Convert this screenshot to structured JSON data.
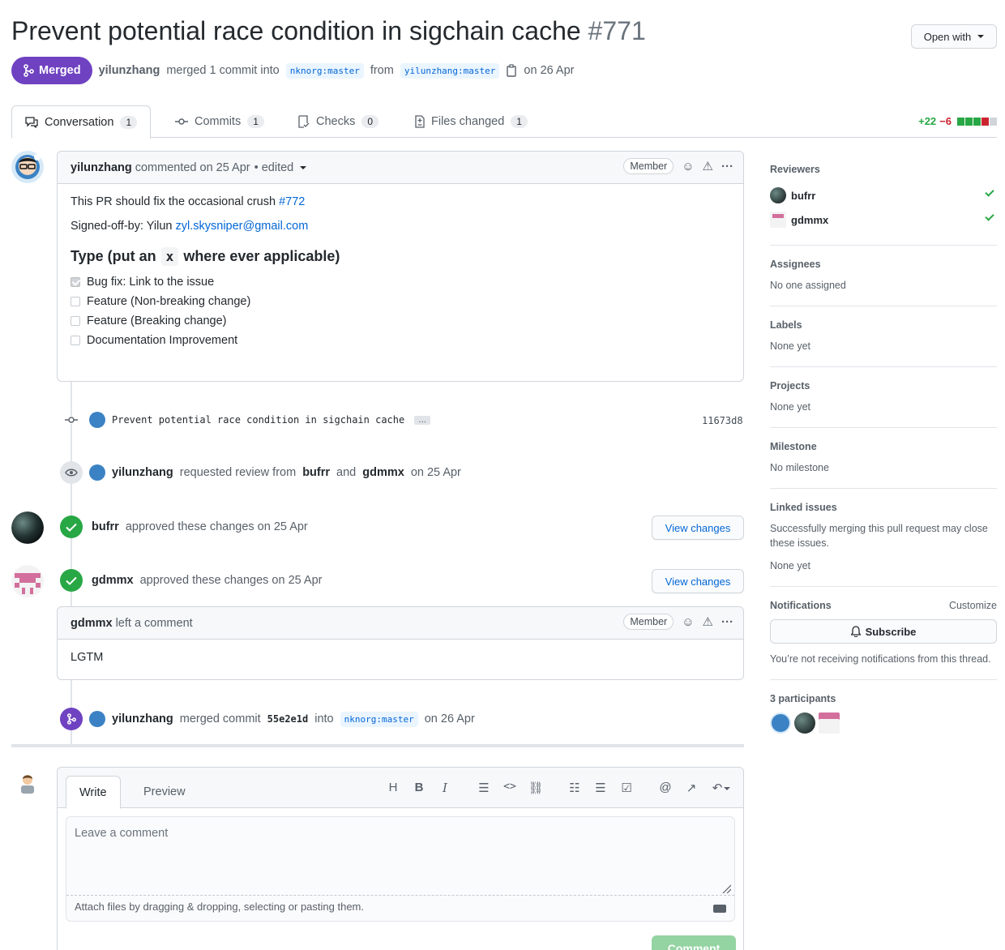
{
  "pr": {
    "title": "Prevent potential race condition in sigchain cache",
    "number": "#771",
    "state": "Merged",
    "author": "yilunzhang",
    "merged_text": "merged 1 commit into",
    "base_branch": "nknorg:master",
    "from_text": "from",
    "head_branch": "yilunzhang:master",
    "date": "on 26 Apr"
  },
  "header": {
    "open_with": "Open with"
  },
  "tabs": [
    {
      "label": "Conversation",
      "count": "1"
    },
    {
      "label": "Commits",
      "count": "1"
    },
    {
      "label": "Checks",
      "count": "0"
    },
    {
      "label": "Files changed",
      "count": "1"
    }
  ],
  "diffstat": {
    "additions": "+22",
    "deletions": "−6"
  },
  "comment1": {
    "author": "yilunzhang",
    "action": "commented on 25 Apr",
    "edited": "• edited",
    "role": "Member",
    "line1": "This PR should fix the occasional crush",
    "issue_link": "#772",
    "signed_off": "Signed-off-by: Yilun",
    "email": "zyl.skysniper@gmail.com",
    "heading_pre": "Type (put an",
    "heading_code": "x",
    "heading_post": "where ever applicable)",
    "tasks": [
      {
        "label": "Bug fix: Link to the issue",
        "checked": true
      },
      {
        "label": "Feature (Non-breaking change)",
        "checked": false
      },
      {
        "label": "Feature (Breaking change)",
        "checked": false
      },
      {
        "label": "Documentation Improvement",
        "checked": false
      }
    ]
  },
  "commit": {
    "message": "Prevent potential race condition in sigchain cache",
    "ellipsis": "…",
    "sha": "11673d8"
  },
  "review_request": {
    "actor": "yilunzhang",
    "text1": "requested review from",
    "reviewer1": "bufrr",
    "text2": "and",
    "reviewer2": "gdmmx",
    "date": "on 25 Apr"
  },
  "approvals": [
    {
      "actor": "bufrr",
      "text": "approved these changes on 25 Apr",
      "button": "View changes"
    },
    {
      "actor": "gdmmx",
      "text": "approved these changes on 25 Apr",
      "button": "View changes"
    }
  ],
  "comment2": {
    "author": "gdmmx",
    "action": "left a comment",
    "role": "Member",
    "body": "LGTM"
  },
  "merge_event": {
    "actor": "yilunzhang",
    "text1": "merged commit",
    "sha": "55e2e1d",
    "text2": "into",
    "branch": "nknorg:master",
    "date": "on 26 Apr"
  },
  "sidebar": {
    "reviewers_title": "Reviewers",
    "reviewers": [
      "bufrr",
      "gdmmx"
    ],
    "assignees_title": "Assignees",
    "assignees_value": "No one assigned",
    "labels_title": "Labels",
    "labels_value": "None yet",
    "projects_title": "Projects",
    "projects_value": "None yet",
    "milestone_title": "Milestone",
    "milestone_value": "No milestone",
    "linked_title": "Linked issues",
    "linked_desc": "Successfully merging this pull request may close these issues.",
    "linked_value": "None yet",
    "notifications_title": "Notifications",
    "customize": "Customize",
    "subscribe": "Subscribe",
    "notif_desc": "You’re not receiving notifications from this thread.",
    "participants_title": "3 participants"
  },
  "editor": {
    "tab_write": "Write",
    "tab_preview": "Preview",
    "placeholder": "Leave a comment",
    "attach": "Attach files by dragging & dropping, selecting or pasting them.",
    "submit": "Comment",
    "toolbar": [
      "H",
      "B",
      "I"
    ]
  },
  "colors": {
    "merged": "#6f42c1",
    "approved": "#28a745",
    "link": "#0366d6",
    "border": "#d1d5da"
  }
}
